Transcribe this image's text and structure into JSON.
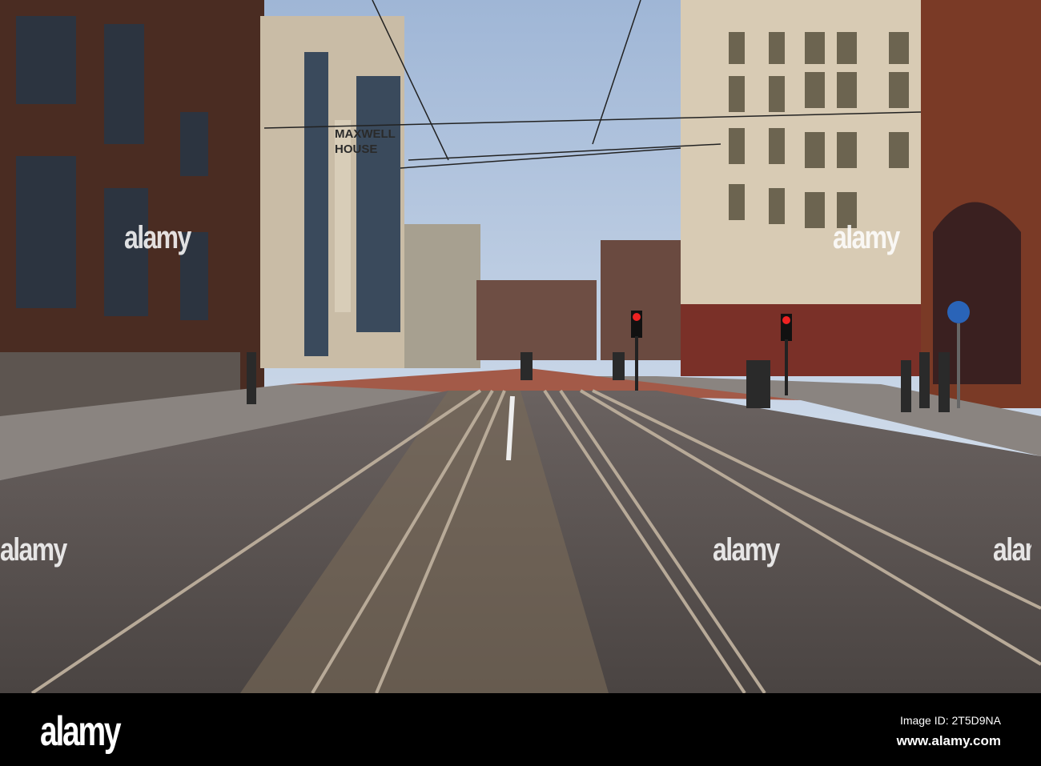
{
  "photo": {
    "building_sign": "MAXWELL HOUSE",
    "watermarks": [
      "alamy",
      "alamy",
      "alamy",
      "alamy",
      "alamy"
    ]
  },
  "footer": {
    "logo": "alamy",
    "image_id": "Image ID: 2T5D9NA",
    "website": "www.alamy.com"
  }
}
